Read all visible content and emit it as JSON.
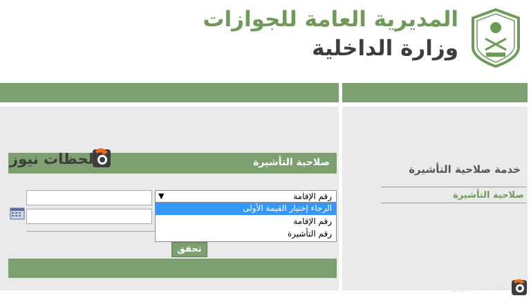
{
  "header": {
    "org_name": "المديرية العامة للجوازات",
    "ministry": "وزارة الداخلية"
  },
  "sidebar": {
    "service_title": "خدمة صلاحية التأشيرة",
    "link": "صلاحية التأشيرة"
  },
  "form": {
    "title": "صلاحية التأشيرة",
    "select": {
      "value": "رقم الإقامة",
      "options": [
        "الرجاء إختيار القيمة الأولى",
        "رقم الإقامة",
        "رقم التأشيرة"
      ]
    },
    "submit_label": "تحقق"
  },
  "watermark": {
    "text": "لحظات نيوز"
  },
  "colors": {
    "green": "#7da070",
    "panel": "#eaeaea",
    "highlight": "#3399ff"
  }
}
